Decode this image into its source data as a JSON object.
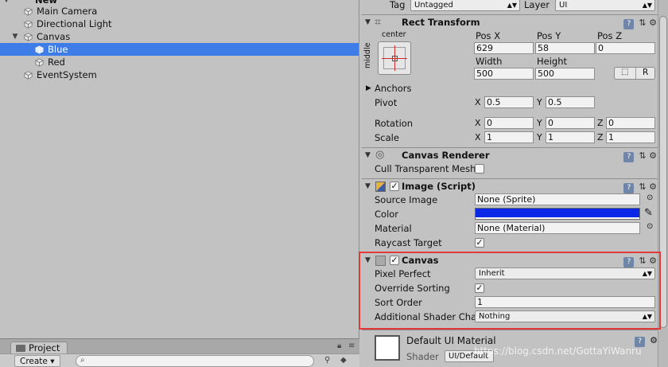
{
  "hierarchy": {
    "scene_name": "New",
    "items": [
      {
        "label": "Main Camera",
        "depth": 1,
        "expandable": false,
        "selected": false
      },
      {
        "label": "Directional Light",
        "depth": 1,
        "expandable": false,
        "selected": false
      },
      {
        "label": "Canvas",
        "depth": 1,
        "expandable": true,
        "selected": false
      },
      {
        "label": "Blue",
        "depth": 2,
        "expandable": false,
        "selected": true
      },
      {
        "label": "Red",
        "depth": 2,
        "expandable": false,
        "selected": false
      },
      {
        "label": "EventSystem",
        "depth": 1,
        "expandable": false,
        "selected": false
      }
    ]
  },
  "project": {
    "tab_label": "Project",
    "create_label": "Create ▾"
  },
  "inspector": {
    "tag": {
      "label": "Tag",
      "value": "Untagged"
    },
    "layer": {
      "label": "Layer",
      "value": "UI"
    },
    "rect_transform": {
      "title": "Rect Transform",
      "anchor_h": "center",
      "anchor_v": "middle",
      "pos_x_label": "Pos X",
      "pos_x": "629",
      "pos_y_label": "Pos Y",
      "pos_y": "58",
      "pos_z_label": "Pos Z",
      "pos_z": "0",
      "width_label": "Width",
      "width": "500",
      "height_label": "Height",
      "height": "500",
      "raw_label": "R",
      "anchors_label": "Anchors",
      "pivot_label": "Pivot",
      "pivot_x": "0.5",
      "pivot_y": "0.5",
      "rotation_label": "Rotation",
      "rot_x": "0",
      "rot_y": "0",
      "rot_z": "0",
      "scale_label": "Scale",
      "scale_x": "1",
      "scale_y": "1",
      "scale_z": "1",
      "axis_x": "X",
      "axis_y": "Y",
      "axis_z": "Z"
    },
    "canvas_renderer": {
      "title": "Canvas Renderer",
      "cull_label": "Cull Transparent Mesh"
    },
    "image": {
      "title": "Image (Script)",
      "source_label": "Source Image",
      "source_value": "None (Sprite)",
      "color_label": "Color",
      "color_value": "#0a28e6",
      "material_label": "Material",
      "material_value": "None (Material)",
      "raycast_label": "Raycast Target"
    },
    "canvas": {
      "title": "Canvas",
      "pixel_perfect_label": "Pixel Perfect",
      "pixel_perfect_value": "Inherit",
      "override_label": "Override Sorting",
      "sort_order_label": "Sort Order",
      "sort_order_value": "1",
      "shader_channels_label": "Additional Shader Cha",
      "shader_channels_value": "Nothing"
    },
    "material_preview": {
      "title": "Default UI Material",
      "shader_label": "Shader",
      "shader_value": "UI/Default"
    }
  },
  "watermark": "https://blog.csdn.net/GottaYiWanru",
  "colors": {
    "selection": "#3e7de7",
    "highlight": "#e03a3a",
    "panel": "#c2c2c2"
  }
}
